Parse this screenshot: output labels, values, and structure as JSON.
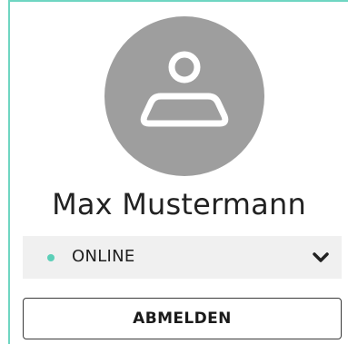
{
  "profile": {
    "avatar_icon": "user-icon",
    "name": "Max Mustermann"
  },
  "status": {
    "label": "ONLINE",
    "dot_color": "#5ccfb8",
    "chevron_icon": "chevron-down-icon"
  },
  "actions": {
    "logout_label": "ABMELDEN"
  },
  "colors": {
    "accent_border": "#6fd6c2",
    "avatar_bg": "#9e9e9e"
  }
}
